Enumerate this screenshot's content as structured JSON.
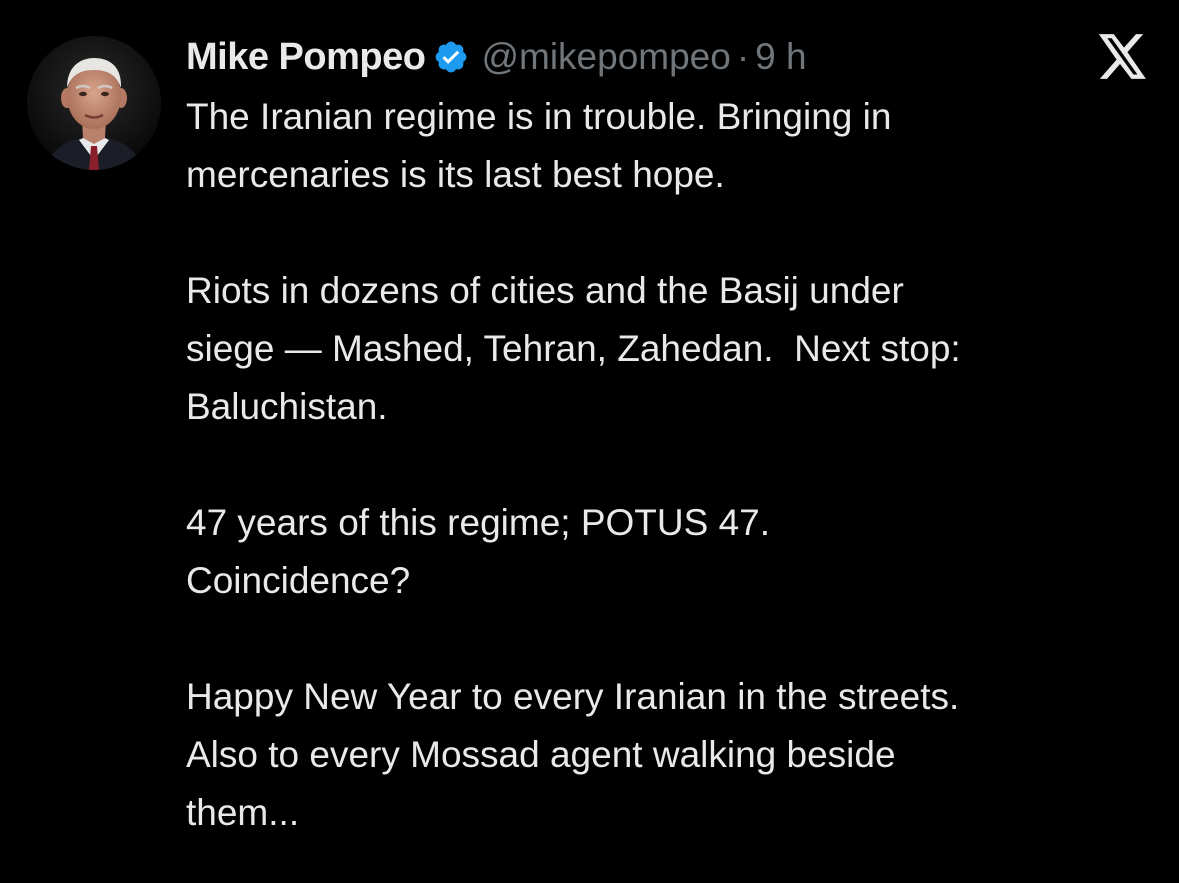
{
  "author": {
    "display_name": "Mike Pompeo",
    "handle": "@mikepompeo",
    "separator": "·",
    "time": "9 h",
    "verified_icon": "verified-badge-icon",
    "avatar_icon": "profile-photo"
  },
  "platform_icon": "x-logo-icon",
  "tweet": {
    "paragraphs": [
      [
        "The Iranian regime is in trouble. Bringing in",
        "mercenaries is its last best hope."
      ],
      [
        "Riots in dozens of cities and the Basij under",
        "siege — Mashed, Tehran, Zahedan.  Next stop:",
        "Baluchistan."
      ],
      [
        "47 years of this regime; POTUS 47.",
        "Coincidence?"
      ],
      [
        "Happy New Year to every Iranian in the streets.",
        "Also to every Mossad agent walking beside",
        "them..."
      ]
    ]
  },
  "colors": {
    "background": "#000000",
    "text": "#e7e9ea",
    "secondary_text": "#71767b",
    "verified_blue": "#1d9bf0"
  }
}
